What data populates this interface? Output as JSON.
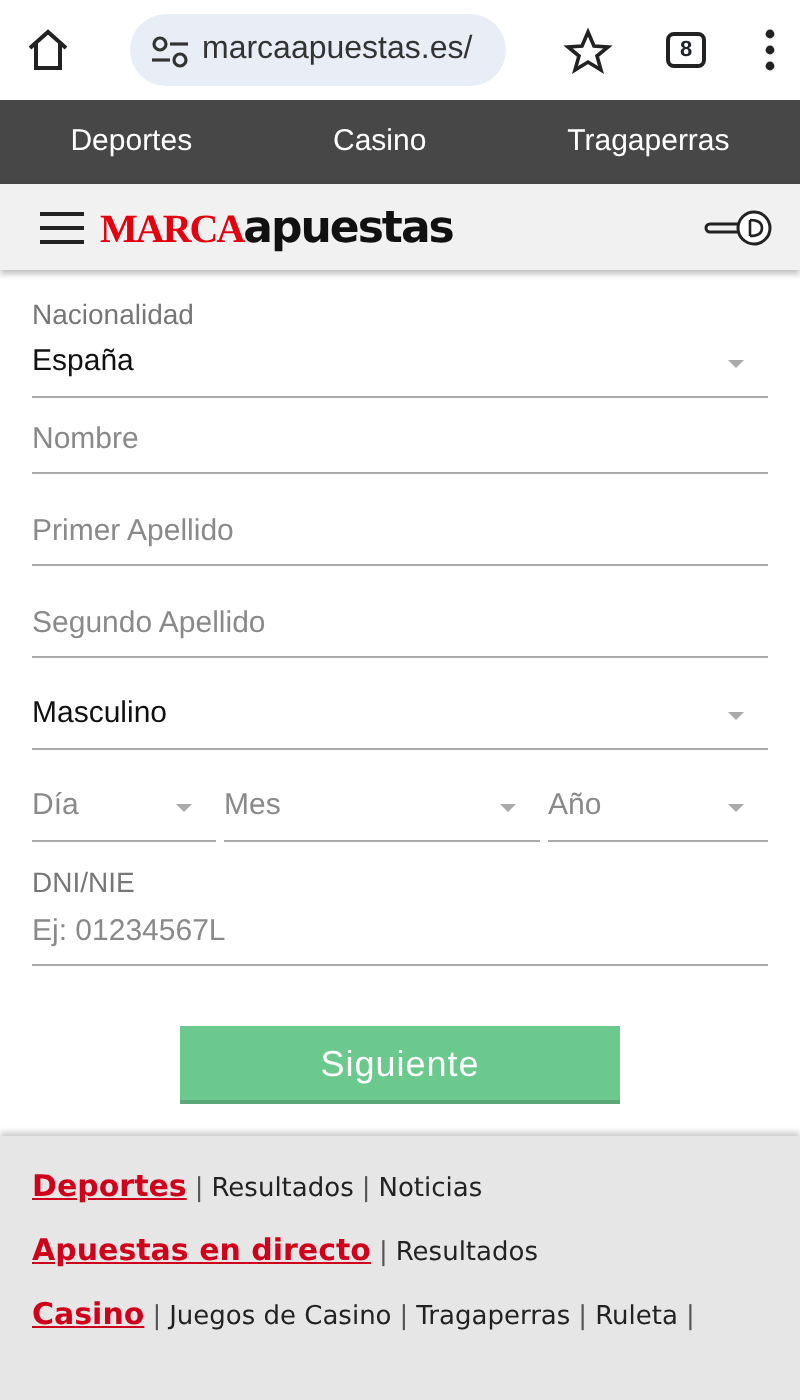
{
  "browser": {
    "url": "marcaapuestas.es/",
    "tab_count": "8"
  },
  "top_nav": [
    {
      "label": "Deportes"
    },
    {
      "label": "Casino"
    },
    {
      "label": "Tragaperras"
    }
  ],
  "logo": {
    "brand": "MARCA",
    "suffix": "apuestas"
  },
  "form": {
    "fields": [
      {
        "kind": "select",
        "label": "Nacionalidad",
        "value": "España"
      },
      {
        "kind": "text",
        "placeholder": "Nombre"
      },
      {
        "kind": "text",
        "placeholder": "Primer Apellido"
      },
      {
        "kind": "text",
        "placeholder": "Segundo Apellido"
      },
      {
        "kind": "select",
        "value": "Masculino"
      },
      {
        "kind": "date",
        "parts": [
          "Día",
          "Mes",
          "Año"
        ]
      },
      {
        "kind": "text",
        "label": "DNI/NIE",
        "placeholder": "Ej: 01234567L"
      }
    ]
  },
  "submit": "Siguiente",
  "footer": [
    {
      "main": "Deportes",
      "links": [
        {
          "sep": "|",
          "label": "Resultados"
        },
        {
          "sep": "|",
          "label": "Noticias"
        }
      ]
    },
    {
      "main": "Apuestas en directo",
      "links": [
        {
          "sep": "|",
          "label": "Resultados"
        }
      ]
    },
    {
      "main": "Casino",
      "links": [
        {
          "sep": "|",
          "label": "Juegos de Casino"
        },
        {
          "sep": "|",
          "label": "Tragaperras"
        },
        {
          "sep": "|",
          "label": "Ruleta"
        }
      ],
      "trailing_sep": "|"
    }
  ]
}
